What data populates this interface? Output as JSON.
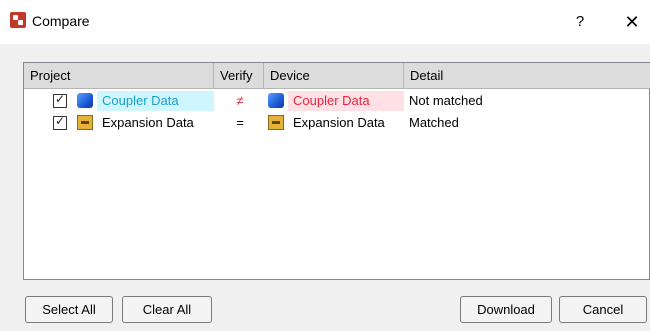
{
  "window": {
    "title": "Compare",
    "help_label": "?",
    "close_label": "✕"
  },
  "table": {
    "columns": [
      "Project",
      "Verify",
      "Device",
      "Detail"
    ],
    "rows": [
      {
        "checked": true,
        "project": "Coupler Data",
        "project_icon": "coupler-cube-icon",
        "verify": "≠",
        "device": "Coupler Data",
        "device_icon": "coupler-cube-icon",
        "detail": "Not matched"
      },
      {
        "checked": true,
        "project": "Expansion Data",
        "project_icon": "expansion-module-icon",
        "verify": "=",
        "device": "Expansion Data",
        "device_icon": "expansion-module-icon",
        "detail": "Matched"
      }
    ]
  },
  "buttons": {
    "select_all": "Select All",
    "clear_all": "Clear All",
    "download": "Download",
    "cancel": "Cancel"
  },
  "colors": {
    "mismatch_text": "#e8253b",
    "project_highlight_text": "#1aa0c8",
    "project_highlight_bg": "#cff6ff",
    "device_highlight_bg": "#ffe0e4"
  }
}
